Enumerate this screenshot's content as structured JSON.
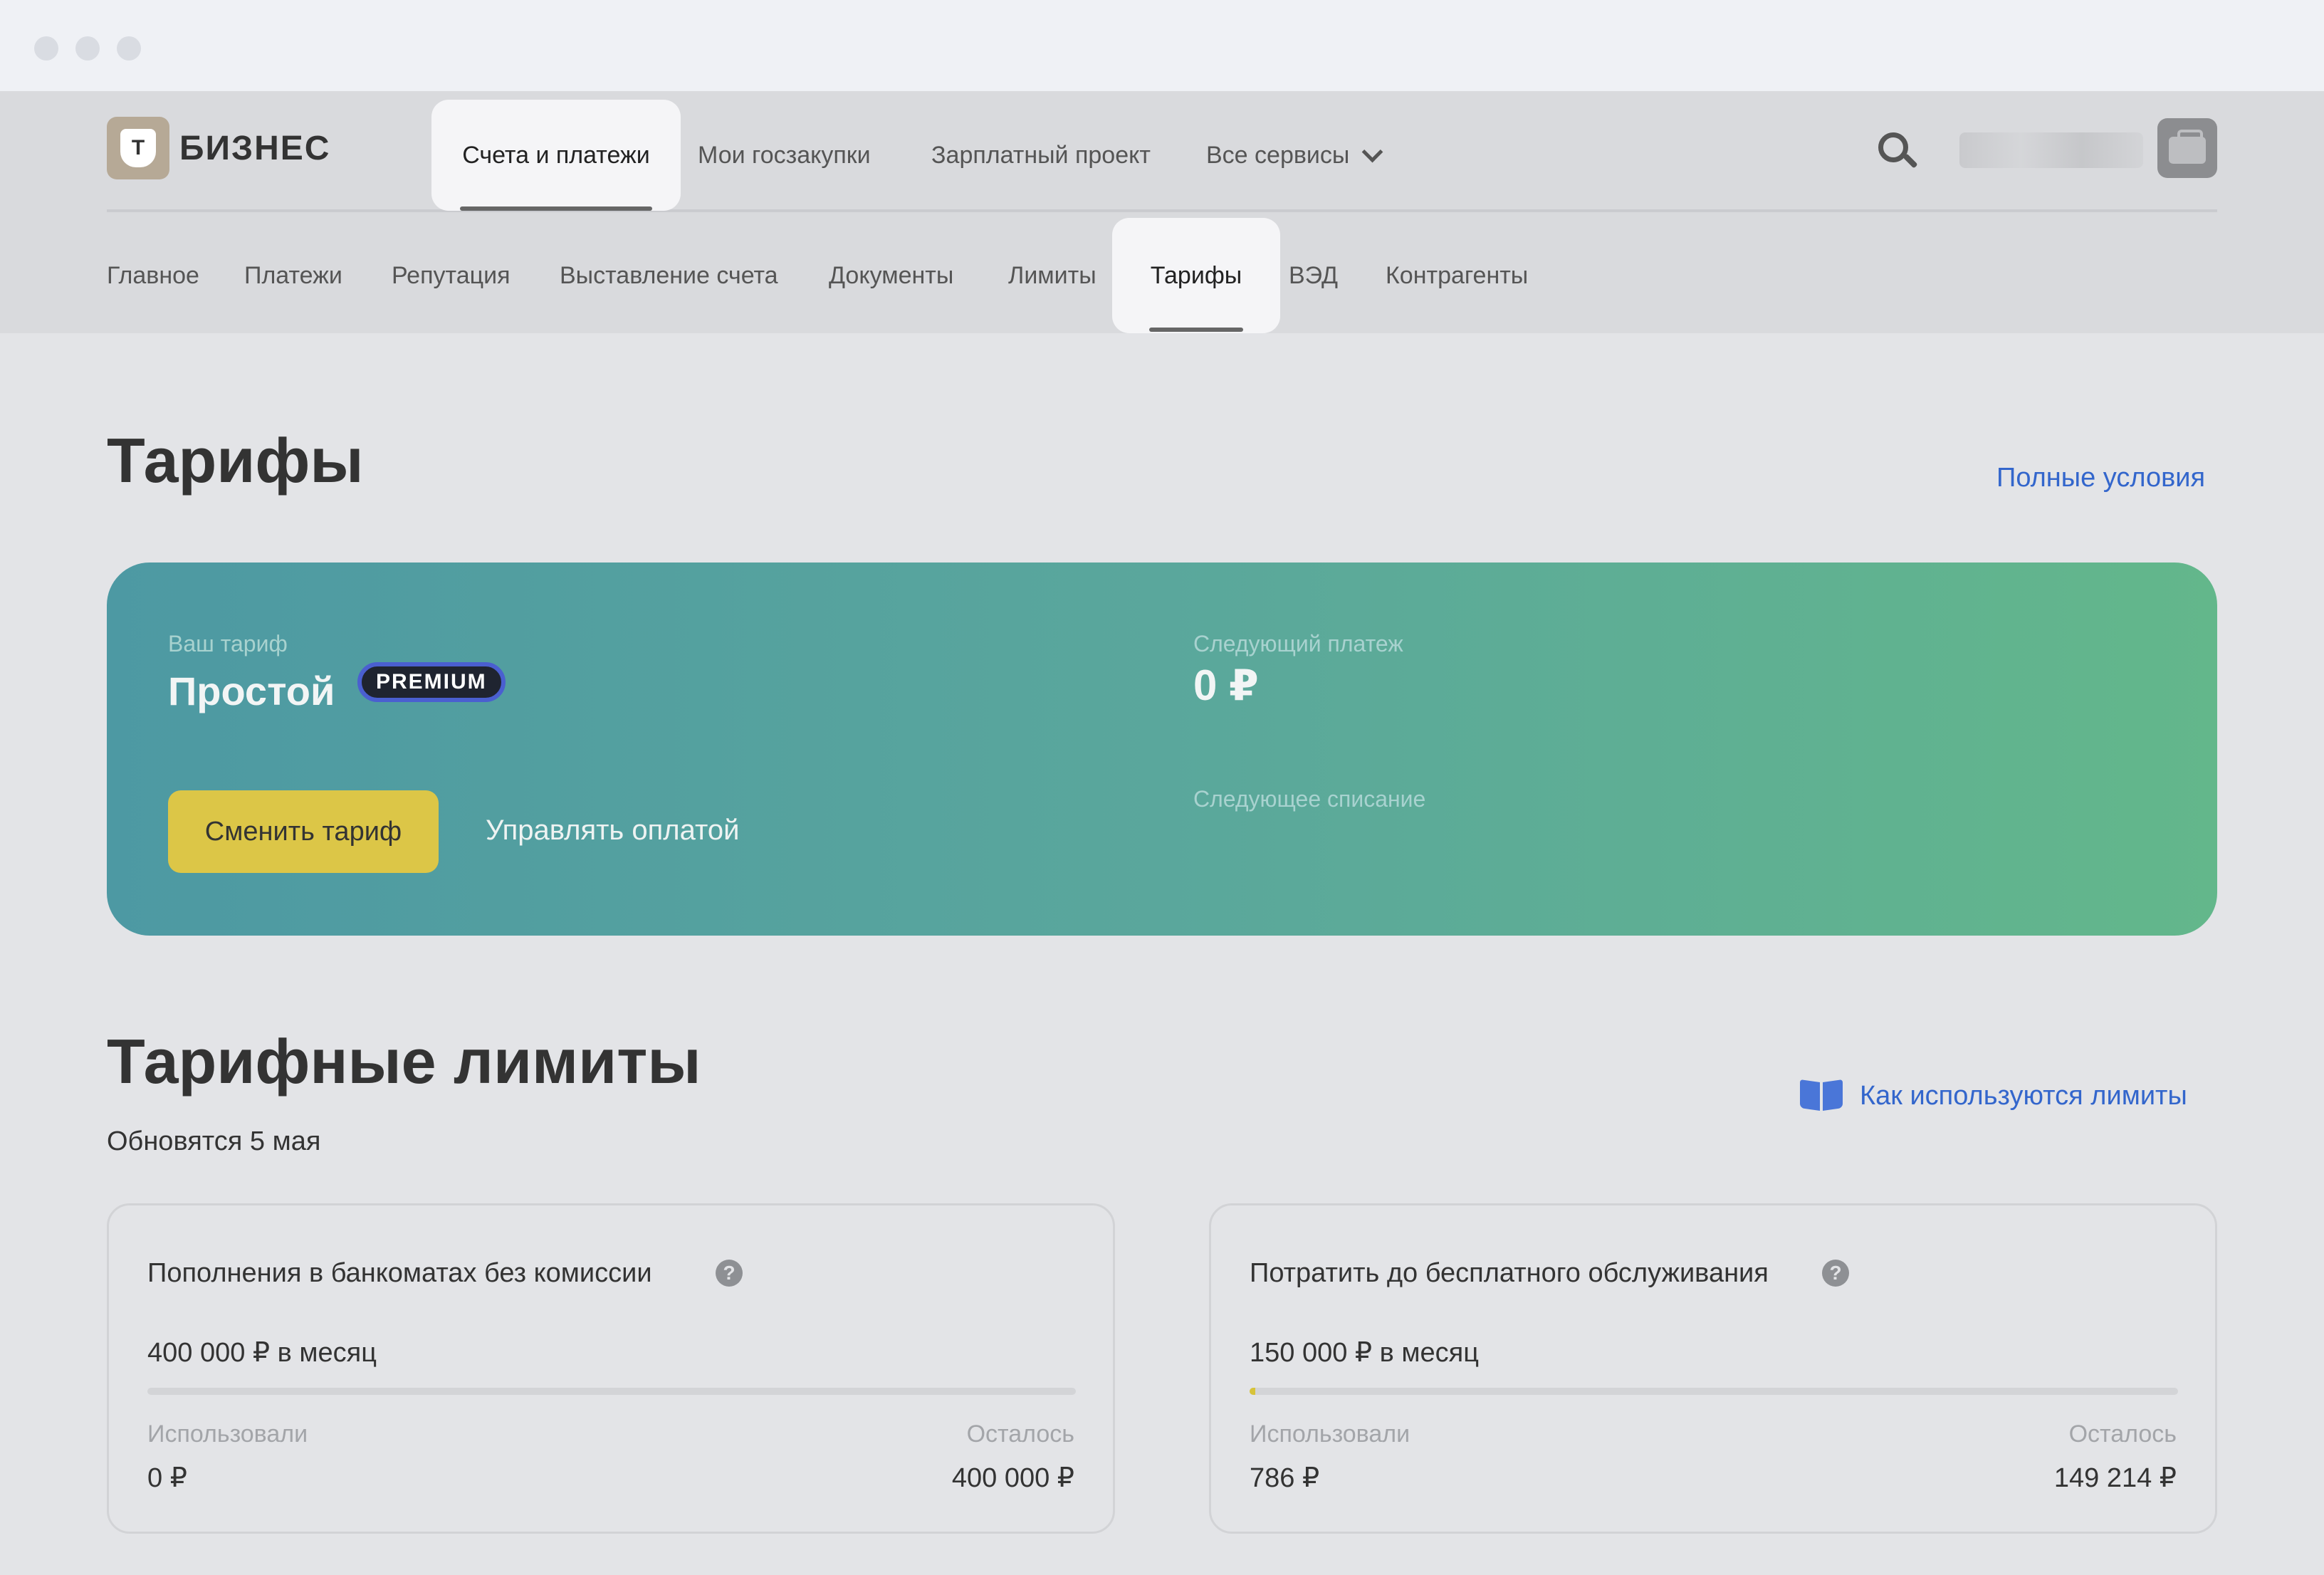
{
  "app": {
    "logo_letter": "Т",
    "logo_text": "БИЗНЕС"
  },
  "nav_top": [
    {
      "label": "Счета и платежи",
      "active": true
    },
    {
      "label": "Мои госзакупки"
    },
    {
      "label": "Зарплатный проект"
    },
    {
      "label": "Все сервисы"
    }
  ],
  "nav_sub": [
    {
      "label": "Главное"
    },
    {
      "label": "Платежи"
    },
    {
      "label": "Репутация"
    },
    {
      "label": "Выставление счета"
    },
    {
      "label": "Документы"
    },
    {
      "label": "Лимиты"
    },
    {
      "label": "Тарифы",
      "active": true
    },
    {
      "label": "ВЭД"
    },
    {
      "label": "Контрагенты"
    }
  ],
  "page": {
    "title": "Тарифы",
    "full_terms_link": "Полные условия"
  },
  "tariff_card": {
    "your_tariff_label": "Ваш тариф",
    "tariff_name": "Простой",
    "badge": "PREMIUM",
    "next_payment_label": "Следующий платеж",
    "next_payment_value": "0 ₽",
    "next_charge_label": "Следующее списание",
    "change_button": "Сменить тариф",
    "manage_button": "Управлять оплатой"
  },
  "limits": {
    "title": "Тарифные лимиты",
    "subtitle": "Обновятся 5 мая",
    "help_link": "Как используются лимиты",
    "cards": [
      {
        "title": "Пополнения в банкоматах без комиссии",
        "amount": "400 000 ₽ в месяц",
        "used_label": "Использовали",
        "left_label": "Осталось",
        "used_value": "0 ₽",
        "left_value": "400 000 ₽",
        "progress": 0
      },
      {
        "title": "Потратить до бесплатного обслуживания",
        "amount": "150 000 ₽ в месяц",
        "used_label": "Использовали",
        "left_label": "Осталось",
        "used_value": "786 ₽",
        "left_value": "149 214 ₽",
        "progress": 0.0052
      }
    ]
  },
  "icons": [
    "logo-icon",
    "chevron-down-icon",
    "search-icon",
    "avatar-icon",
    "book-icon",
    "question-icon"
  ],
  "colors": {
    "accent_link": "#3366cc",
    "button_yellow": "#dcc647",
    "card_gradient_start": "#4d99a3",
    "card_gradient_end": "#63b78b",
    "badge_border": "#4a5fd0"
  }
}
